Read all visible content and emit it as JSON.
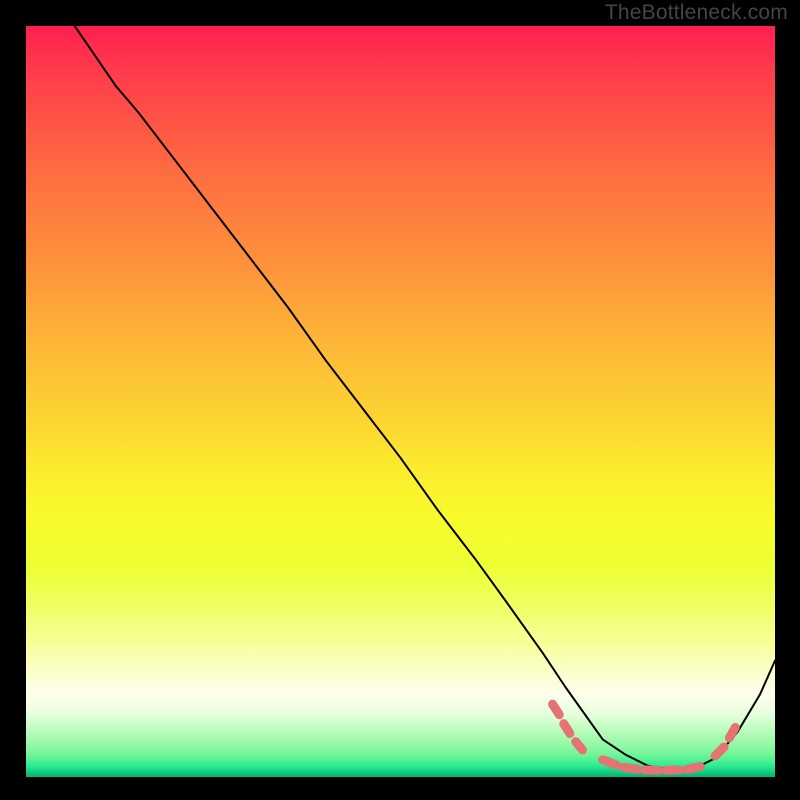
{
  "watermark": "TheBottleneck.com",
  "chart_data": {
    "type": "line",
    "title": "",
    "xlabel": "",
    "ylabel": "",
    "xlim": [
      0,
      100
    ],
    "ylim": [
      0,
      100
    ],
    "grid": false,
    "series": [
      {
        "name": "bottleneck-curve",
        "color": "#000000",
        "x": [
          6.5,
          12,
          15,
          20,
          25,
          30,
          35,
          40,
          45,
          50,
          55,
          60,
          64,
          69,
          72,
          77,
          80,
          83,
          86,
          89,
          92,
          95,
          98,
          100
        ],
        "y": [
          100,
          92,
          88.5,
          82,
          75.5,
          69,
          62.5,
          55.5,
          49,
          42.5,
          35.5,
          29,
          23.5,
          16.5,
          12,
          5,
          3,
          1.5,
          1,
          1,
          2.5,
          6,
          11,
          15.5
        ]
      }
    ],
    "markers": [
      {
        "name": "highlight-dashes",
        "color": "#E57373",
        "segments": [
          {
            "x1": 70.3,
            "y1": 9.7,
            "x2": 71.2,
            "y2": 8.3
          },
          {
            "x1": 71.8,
            "y1": 7.1,
            "x2": 72.6,
            "y2": 5.8
          },
          {
            "x1": 73.4,
            "y1": 4.7,
            "x2": 74.3,
            "y2": 3.6
          },
          {
            "x1": 77.0,
            "y1": 2.3,
            "x2": 78.8,
            "y2": 1.6
          },
          {
            "x1": 79.8,
            "y1": 1.3,
            "x2": 81.6,
            "y2": 1.05
          },
          {
            "x1": 82.6,
            "y1": 0.95,
            "x2": 84.4,
            "y2": 0.9
          },
          {
            "x1": 85.4,
            "y1": 0.9,
            "x2": 87.2,
            "y2": 0.95
          },
          {
            "x1": 88.2,
            "y1": 1.0,
            "x2": 90.0,
            "y2": 1.4
          },
          {
            "x1": 92.0,
            "y1": 2.8,
            "x2": 93.2,
            "y2": 4.0
          },
          {
            "x1": 93.9,
            "y1": 5.2,
            "x2": 94.7,
            "y2": 6.6
          }
        ]
      }
    ],
    "gradient_colors": {
      "top": "#FF1F50",
      "mid_upper": "#FD963B",
      "mid": "#FCEC2E",
      "mid_lower": "#F6FF97",
      "bottom": "#00B474"
    }
  }
}
